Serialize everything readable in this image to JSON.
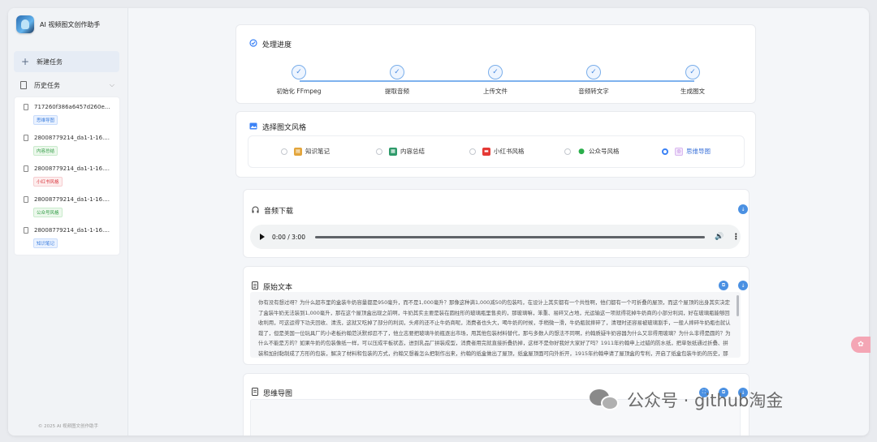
{
  "app": {
    "title": "AI 视频图文创作助手",
    "footer": "© 2025 AI 视频图文创作助手"
  },
  "sidebar": {
    "new_task": "新建任务",
    "history_label": "历史任务",
    "history": [
      {
        "name": "717260f386a6457d260e...",
        "badge": "思维导图",
        "badge_color": "blue"
      },
      {
        "name": "28008779214_da1-1-16....",
        "badge": "内容总结",
        "badge_color": "green"
      },
      {
        "name": "28008779214_da1-1-16....",
        "badge": "小红书风格",
        "badge_color": "red"
      },
      {
        "name": "28008779214_da1-1-16....",
        "badge": "公众号风格",
        "badge_color": "green"
      },
      {
        "name": "28008779214_da1-1-16....",
        "badge": "知识笔记",
        "badge_color": "blue"
      }
    ]
  },
  "progress": {
    "title": "处理进度",
    "steps": [
      "初始化 FFmpeg",
      "提取音频",
      "上传文件",
      "音频转文字",
      "生成图文"
    ]
  },
  "style": {
    "title": "选择图文风格",
    "options": [
      {
        "label": "知识笔记",
        "icon": "notebook-icon",
        "color": "#e3a53b"
      },
      {
        "label": "内容总结",
        "icon": "summary-icon",
        "color": "#2e9a6a"
      },
      {
        "label": "小红书风格",
        "icon": "xiaohongshu-icon",
        "color": "#e53935"
      },
      {
        "label": "公众号风格",
        "icon": "wechat-icon",
        "color": "#2aae4a"
      },
      {
        "label": "思维导图",
        "icon": "mindmap-icon",
        "color": "#b06fd8"
      }
    ],
    "selected": "思维导图"
  },
  "audio": {
    "title": "音频下载",
    "time": "0:00 / 3:00"
  },
  "transcript": {
    "title": "原始文本",
    "text": "你有没有想过呀？为什么超市里的盒装牛奶容量都是950毫升，而不是1,000毫升？那像这种满1,000减50的包装吗，在设计上其实都有一个共性啊，他们都有一个可折叠的屋顶，而这个屋顶的出身其实决定了盒装牛奶无法装到1,000毫升，那在这个屋顶盒出现之前啊，牛奶其实主要是装在圆柱形的玻璃瓶里售卖的，那玻璃嘛，笨重、易碎又占地，光运输这一项就得花掉牛奶商的小部分利润，好在玻璃瓶能够回收利用，可这运得下功夫回收、清洗，这就又吃掉了部分的利润，头疼的还不止牛奶商呢，消费者也头大，喝牛奶的时候，手稍微一滑，牛奶瓶就摔碎了，清理时还容易被玻璃割手，一般人摔碎牛奶瓶也就认栽了，但是美国一位玩具厂的小老板约翰范沃默却忍不了，他立志要把玻璃牛奶瓶逐出市场，用其他包装材料替代，那与多数人的想法不同啊，约翰质疑牛奶容器为什么又非得用玻璃？为什么非得是圆的？为什么不能是方的？如果牛奶的包装像纸一样，可以压成平板状态，进到乳品厂拼装成型，消费者用完就直接折叠扔掉，这样不是你好我好大家好了吗？1911年约翰申上过蜡的防水纸，把单张纸通过折叠、拼装和加封黏制成了方形的包装，解决了材料和包装的方式，约翰又想着怎么把制作出来，约翰的纸盒做出了屋顶，纸盒屋顶面可向外折开，1915年约翰申请了屋顶盒的专利，开启了纸盒包装牛奶的历史，那专利"
  },
  "mindmap": {
    "title": "思维导图"
  },
  "watermark": "公众号 · github淘金"
}
